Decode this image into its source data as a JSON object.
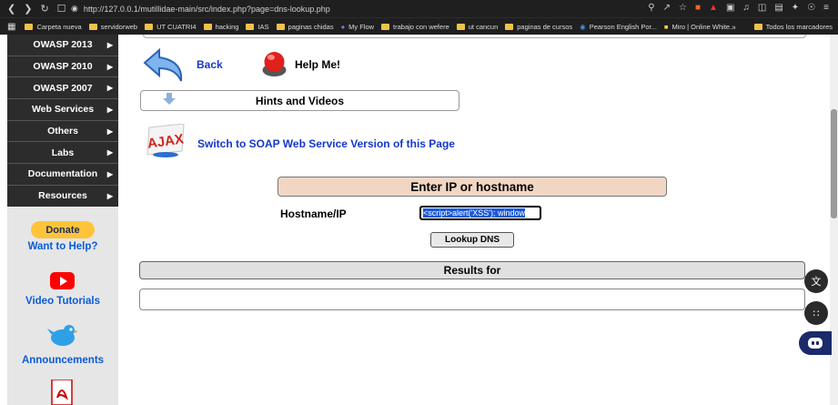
{
  "browser": {
    "url": "http://127.0.0.1/mutillidae-main/src/index.php?page=dns-lookup.php",
    "bookmarks": [
      "Carpeta nueva",
      "servidorweb",
      "UT CUATRI4",
      "hacking",
      "IAS",
      "paginas chidas",
      "My Flow",
      "trabajo con wefere",
      "ut cancun",
      "paginas de cursos",
      "Pearson English Por...",
      "Miro | Online White..."
    ],
    "bookmarks_overflow": "»",
    "all_bookmarks": "Todos los marcadores"
  },
  "menu": {
    "items": [
      "OWASP 2013",
      "OWASP 2010",
      "OWASP 2007",
      "Web Services",
      "Others",
      "Labs",
      "Documentation",
      "Resources"
    ]
  },
  "left": {
    "donate": "Donate",
    "want_help": "Want to Help?",
    "video_tutorials": "Video Tutorials",
    "announcements": "Announcements"
  },
  "page": {
    "back": "Back",
    "help": "Help Me!",
    "hints": "Hints and Videos",
    "soap_link": "Switch to SOAP Web Service Version of this Page",
    "form_header": "Enter IP or hostname",
    "host_label": "Hostname/IP",
    "host_value": "<script>alert('XSS'); window",
    "lookup_button": "Lookup DNS",
    "results_header": "Results for"
  },
  "colors": {
    "link": "#1438c8",
    "menu_bg": "#2c2c2c",
    "form_header_bg": "#f2d6c4"
  }
}
